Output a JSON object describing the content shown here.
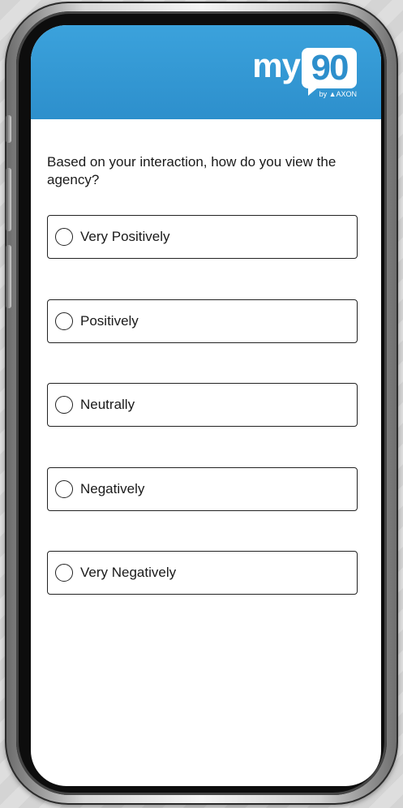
{
  "header": {
    "logo_prefix": "my",
    "logo_number": "90",
    "logo_byline": "by ▲AXON",
    "brand_color": "#3ba2dc"
  },
  "survey": {
    "question": "Based on your interaction, how do you view the agency?",
    "options": [
      {
        "label": "Very Positively",
        "selected": false
      },
      {
        "label": "Positively",
        "selected": false
      },
      {
        "label": "Neutrally",
        "selected": false
      },
      {
        "label": "Negatively",
        "selected": false
      },
      {
        "label": "Very Negatively",
        "selected": false
      }
    ]
  }
}
